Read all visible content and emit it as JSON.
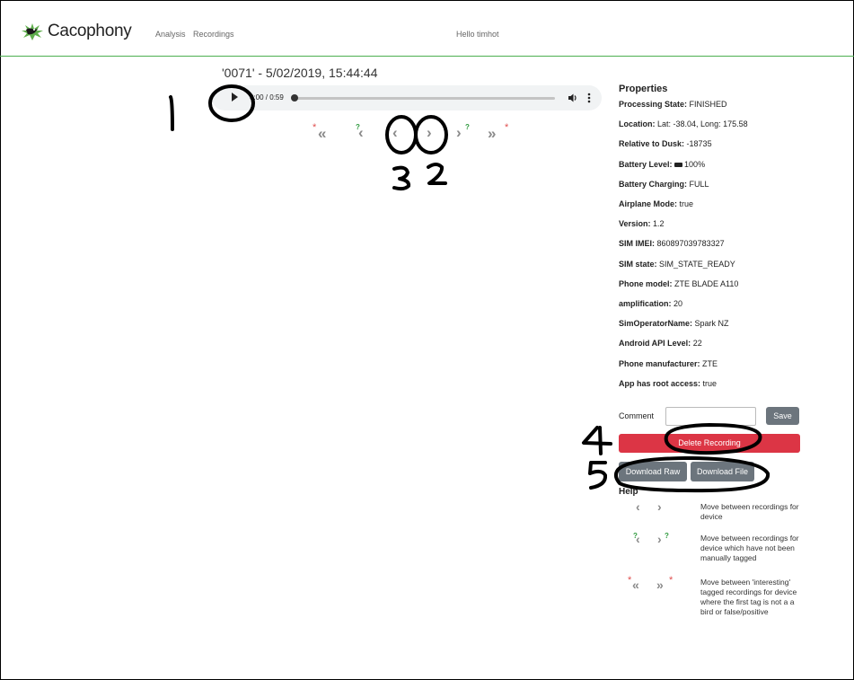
{
  "navbar": {
    "brand": "Cacophony",
    "links": [
      "Analysis",
      "Recordings"
    ],
    "greeting": "Hello timhot"
  },
  "recording": {
    "title": "'0071' - 5/02/2019, 15:44:44"
  },
  "player": {
    "time": "0:00 / 0:59",
    "progress": 0.0
  },
  "nav_icons": [
    "interesting-prev",
    "untagged-prev",
    "prev",
    "next",
    "untagged-next",
    "interesting-next"
  ],
  "properties": {
    "title": "Properties",
    "items": [
      {
        "key": "Processing State:",
        "value": "FINISHED"
      },
      {
        "key": "Location:",
        "value": "Lat: -38.04, Long: 175.58"
      },
      {
        "key": "Relative to Dusk:",
        "value": "-18735"
      },
      {
        "key": "Battery Level:",
        "value": "100%"
      },
      {
        "key": "Battery Charging:",
        "value": "FULL"
      },
      {
        "key": "Airplane Mode:",
        "value": "true"
      },
      {
        "key": "Version:",
        "value": "1.2"
      },
      {
        "key": "SIM IMEI:",
        "value": "860897039783327"
      },
      {
        "key": "SIM state:",
        "value": "SIM_STATE_READY"
      },
      {
        "key": "Phone model:",
        "value": "ZTE BLADE A110"
      },
      {
        "key": "amplification:",
        "value": "20"
      },
      {
        "key": "SimOperatorName:",
        "value": "Spark NZ"
      },
      {
        "key": "Android API Level:",
        "value": "22"
      },
      {
        "key": "Phone manufacturer:",
        "value": "ZTE"
      },
      {
        "key": "App has root access:",
        "value": "true"
      }
    ]
  },
  "comment": {
    "label": "Comment",
    "value": "",
    "save_label": "Save"
  },
  "actions": {
    "delete_label": "Delete Recording",
    "download_raw_label": "Download Raw",
    "download_file_label": "Download File"
  },
  "help": {
    "title": "Help",
    "rows": [
      {
        "text": "Move between recordings for device"
      },
      {
        "text": "Move between recordings for device which have not been manually tagged"
      },
      {
        "text": "Move between 'interesting' tagged recordings for device where the first tag is not a a bird or false/positive"
      }
    ]
  },
  "annotations": [
    "1",
    "2",
    "3",
    "4",
    "5"
  ],
  "colors": {
    "nav_border": "#4caf50",
    "delete": "#dc3545",
    "secondary": "#6c757d",
    "star": "#e04f4f",
    "untagged": "#2e9a3e"
  }
}
